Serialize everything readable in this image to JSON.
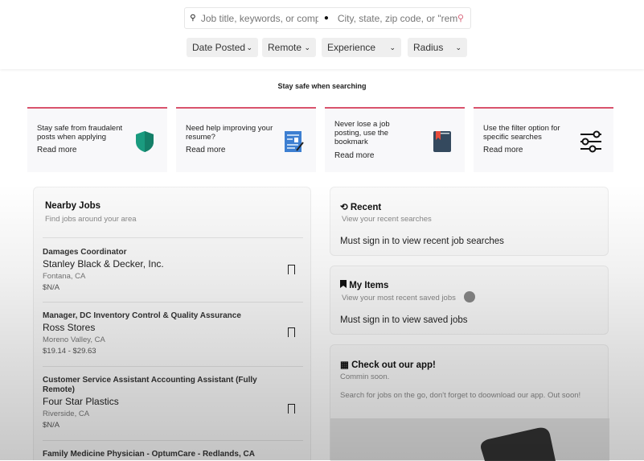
{
  "search": {
    "keyword_placeholder": "Job title, keywords, or compa",
    "location_placeholder": "City, state, zip code, or \"rem",
    "search_icon": "search-icon",
    "location_icon": "map-pin-icon"
  },
  "filters": [
    {
      "label": "Date Posted"
    },
    {
      "label": "Remote"
    },
    {
      "label": "Experience"
    },
    {
      "label": "Radius"
    }
  ],
  "safety": {
    "title": "Stay safe when searching",
    "tips": [
      {
        "text": "Stay safe from fraudalent posts when applying",
        "link": "Read more",
        "icon": "shield-icon"
      },
      {
        "text": "Need help improving your resume?",
        "link": "Read more",
        "icon": "resume-icon"
      },
      {
        "text": "Never lose a job posting, use the bookmark",
        "link": "Read more",
        "icon": "bookmark-book-icon"
      },
      {
        "text": "Use the filter option for specific searches",
        "link": "Read more",
        "icon": "sliders-icon"
      }
    ]
  },
  "nearby": {
    "title": "Nearby Jobs",
    "subtitle": "Find jobs around your area",
    "jobs": [
      {
        "title": "Damages Coordinator",
        "company": "Stanley Black & Decker, Inc.",
        "location": "Fontana, CA",
        "pay": "$N/A"
      },
      {
        "title": "Manager, DC Inventory Control & Quality Assurance",
        "company": "Ross Stores",
        "location": "Moreno Valley, CA",
        "pay": "$19.14 - $29.63"
      },
      {
        "title": "Customer Service Assistant Accounting Assistant (Fully Remote)",
        "company": "Four Star Plastics",
        "location": "Riverside, CA",
        "pay": "$N/A"
      },
      {
        "title": "Family Medicine Physician - OptumCare - Redlands, CA"
      }
    ]
  },
  "recent": {
    "title": "Recent",
    "subtitle": "View your recent searches",
    "message": "Must sign in to view recent job searches"
  },
  "my_items": {
    "title": "My Items",
    "subtitle": "View your most recent saved jobs",
    "message": "Must sign in to view saved jobs"
  },
  "app": {
    "title": "Check out our app!",
    "subtitle": "Commin soon.",
    "description": "Search for jobs on the go, don't forget to doownload our app. Out soon!"
  },
  "colors": {
    "accent": "#d9536c",
    "shield": "#1a9b7f"
  }
}
